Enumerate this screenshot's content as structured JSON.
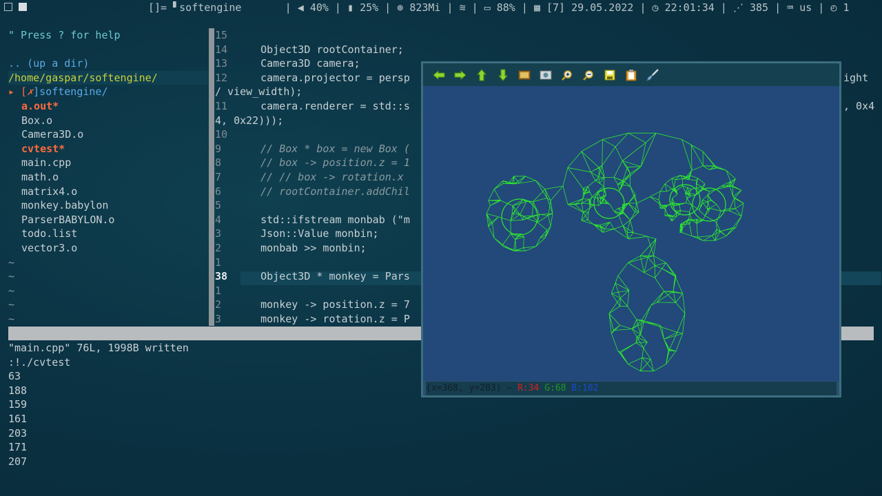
{
  "topbar": {
    "layout_indicator": "[]=",
    "window_title": "softengine",
    "volume": "40%",
    "brightness": "25%",
    "memory": "823Mi",
    "battery": "88%",
    "date": "[7] 29.05.2022",
    "time": "22:01:34",
    "feed_count": "385",
    "keyboard": "us",
    "clock_count": "1"
  },
  "tree": {
    "help": "\" Press ? for help",
    "updir": ".. (up a dir)",
    "path": "/home/gaspar/softengine/",
    "root_prefix": "▸ [",
    "root_mark": "✗",
    "root_name": "]softengine/",
    "files": [
      {
        "name": "a.out*",
        "exec": true
      },
      {
        "name": "Box.o",
        "exec": false
      },
      {
        "name": "Camera3D.o",
        "exec": false
      },
      {
        "name": "cvtest*",
        "exec": true
      },
      {
        "name": "main.cpp",
        "exec": false
      },
      {
        "name": "math.o",
        "exec": false
      },
      {
        "name": "matrix4.o",
        "exec": false
      },
      {
        "name": "monkey.babylon",
        "exec": false
      },
      {
        "name": "ParserBABYLON.o",
        "exec": false
      },
      {
        "name": "todo.list",
        "exec": false
      },
      {
        "name": "vector3.o",
        "exec": false
      }
    ],
    "tilde": "~"
  },
  "editor": {
    "lines": [
      {
        "num": "15",
        "text": ""
      },
      {
        "num": "14",
        "text": "    Object3D rootContainer;"
      },
      {
        "num": "13",
        "text": "    Camera3D camera;"
      },
      {
        "num": "12",
        "text": "    camera.projector = persp",
        "tail": "ight"
      },
      {
        "num": "",
        "text": "/ view_width);"
      },
      {
        "num": "11",
        "text": "    camera.renderer = std::s",
        "tail": ", 0x4"
      },
      {
        "num": "",
        "text": "4, 0x22)));"
      },
      {
        "num": "10",
        "text": ""
      },
      {
        "num": "9",
        "text": "    // Box * box = new Box (",
        "comment": true
      },
      {
        "num": "8",
        "text": "    // box -> position.z = 1",
        "comment": true
      },
      {
        "num": "7",
        "text": "    // // box -> rotation.x ",
        "comment": true
      },
      {
        "num": "6",
        "text": "    // rootContainer.addChil",
        "comment": true
      },
      {
        "num": "5",
        "text": ""
      },
      {
        "num": "4",
        "text": "    std::ifstream monbab (\"m"
      },
      {
        "num": "3",
        "text": "    Json::Value monbin;"
      },
      {
        "num": "2",
        "text": "    monbab >> monbin;"
      },
      {
        "num": "1",
        "text": ""
      },
      {
        "num": "38",
        "text": "    Object3D * monkey = Pars",
        "current": true
      },
      {
        "num": "1",
        "text": ""
      },
      {
        "num": "2",
        "text": "    monkey -> position.z = 7"
      },
      {
        "num": "3",
        "text": "    monkey -> rotation.z = P"
      }
    ]
  },
  "command": {
    "written": "\"main.cpp\" 76L, 1998B written",
    "cmd": ":!./cvtest",
    "output": [
      "63",
      "188",
      "159",
      "161",
      "203",
      "171",
      "207"
    ]
  },
  "viewer": {
    "toolbar_icons": [
      "arrow-left-icon",
      "arrow-right-icon",
      "arrow-up-icon",
      "arrow-down-icon",
      "image-icon",
      "photo-icon",
      "zoom-in-icon",
      "zoom-out-icon",
      "save-icon",
      "clipboard-icon",
      "brush-icon"
    ],
    "status": {
      "coords": "(x=368, y=203) ~ ",
      "r": "R:34",
      "g": "G:68",
      "b": "B:102"
    },
    "colors": {
      "wire": "#2fe82f",
      "canvas": "#22497a"
    }
  }
}
